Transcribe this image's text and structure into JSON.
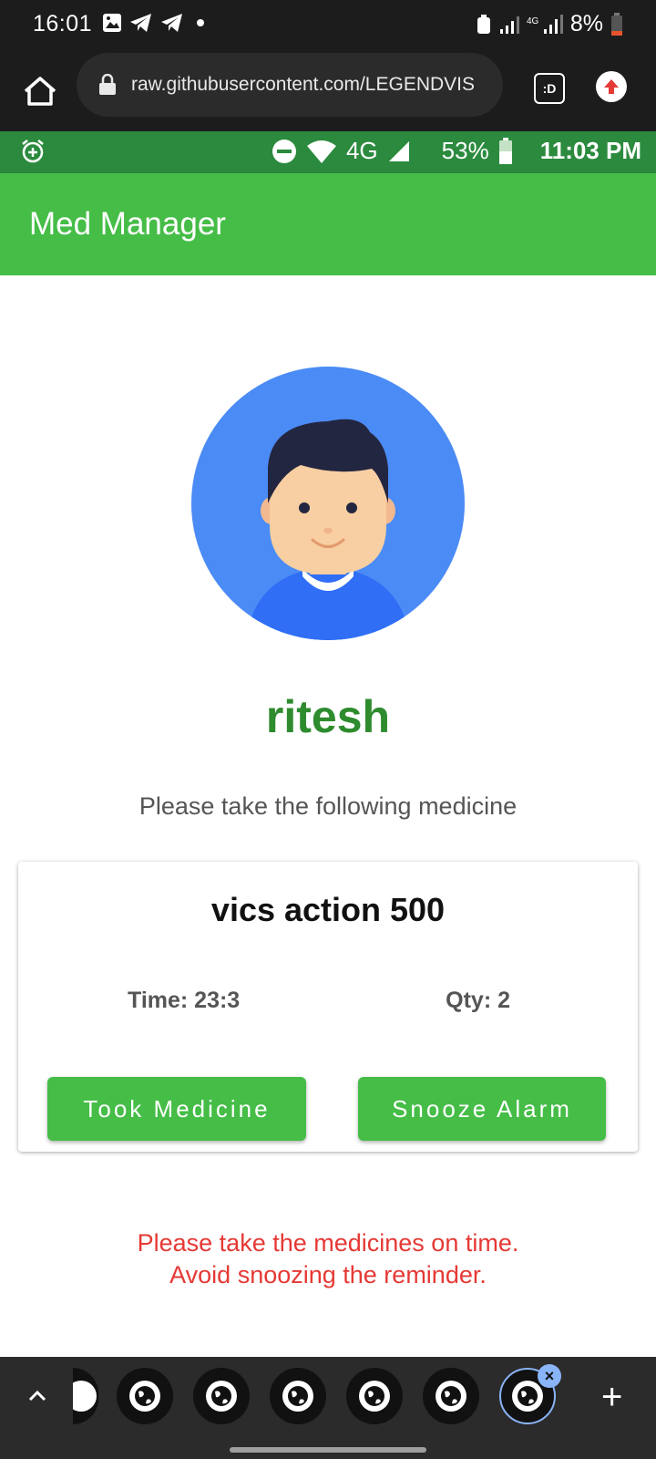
{
  "device_status": {
    "time": "16:01",
    "battery": "8%"
  },
  "browser": {
    "url": "raw.githubusercontent.com/LEGENDVIS",
    "tab_label": ":D"
  },
  "app_status": {
    "network": "4G",
    "battery": "53%",
    "time": "11:03 PM"
  },
  "toolbar": {
    "title": "Med Manager"
  },
  "user": {
    "name": "ritesh"
  },
  "prompt": "Please take the following medicine",
  "medicine": {
    "name": "vics action 500",
    "time": "Time: 23:3",
    "qty": "Qty: 2"
  },
  "actions": {
    "took_label": "Took Medicine",
    "snooze_label": "Snooze Alarm"
  },
  "warning": {
    "line1": "Please take the medicines on time.",
    "line2": "Avoid snoozing the reminder."
  },
  "colors": {
    "toolbar": "#45bd47",
    "username": "#2e8b2e",
    "warning": "#e53935"
  }
}
